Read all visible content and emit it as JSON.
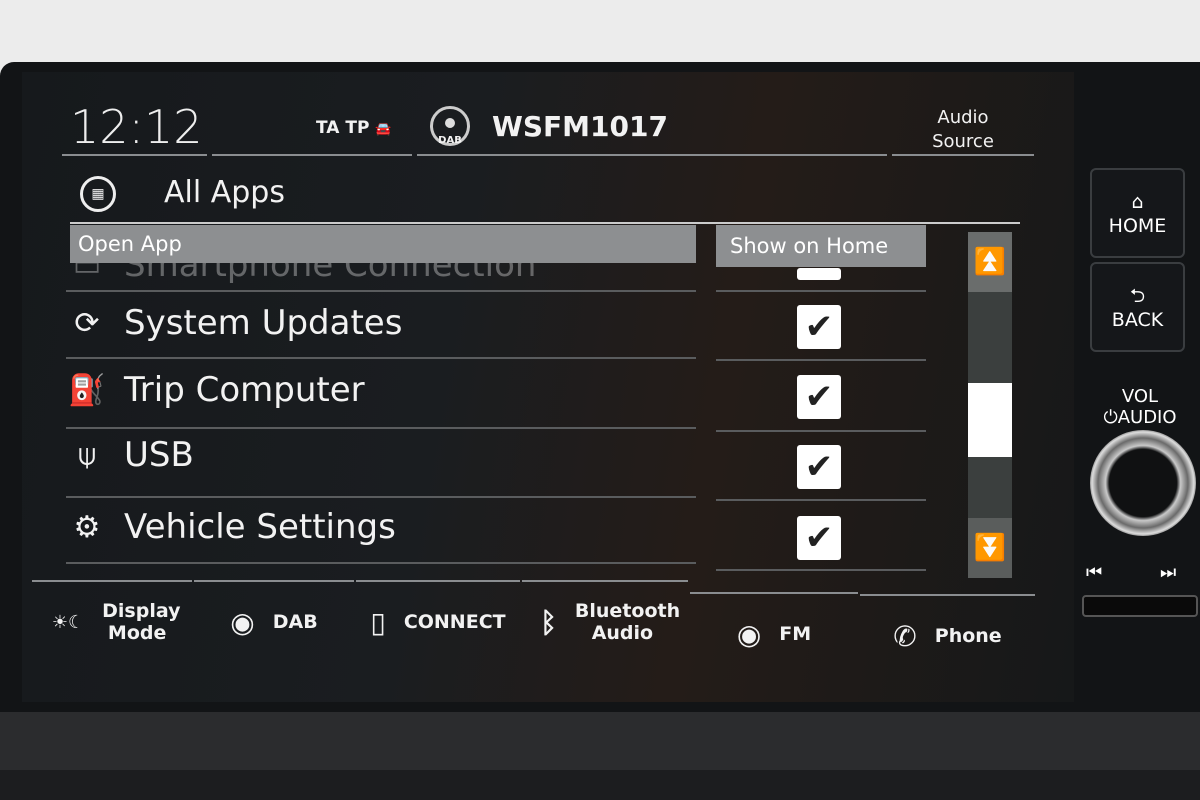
{
  "status": {
    "time": "12:12",
    "ta_tp": "TA TP",
    "traffic_icon": "traffic-signal-icon",
    "source_badge": "DAB",
    "station": "WSFM1017",
    "audio_source": "Audio Source"
  },
  "header": {
    "title": "All Apps",
    "icon": "grid-icon"
  },
  "columns": {
    "open_app": "Open App",
    "show_on_home": "Show on Home"
  },
  "apps": [
    {
      "label": "Smartphone Connection",
      "icon": "smartphone-icon",
      "checked": true
    },
    {
      "label": "System Updates",
      "icon": "refresh-icon",
      "checked": true
    },
    {
      "label": "Trip Computer",
      "icon": "fuel-pump-icon",
      "checked": true
    },
    {
      "label": "USB",
      "icon": "usb-icon",
      "checked": true
    },
    {
      "label": "Vehicle Settings",
      "icon": "car-gear-icon",
      "checked": true
    }
  ],
  "scroll": {
    "position_percent": 60
  },
  "bottom_bar": [
    {
      "label": "Display Mode",
      "icon": "sun-moon-icon"
    },
    {
      "label": "DAB",
      "icon": "broadcast-icon"
    },
    {
      "label": "CONNECT",
      "icon": "phone-device-icon"
    },
    {
      "label": "Bluetooth Audio",
      "icon": "bluetooth-icon"
    },
    {
      "label": "FM",
      "icon": "broadcast-icon"
    },
    {
      "label": "Phone",
      "icon": "phone-handset-icon"
    }
  ],
  "hardware": {
    "home": "HOME",
    "back": "BACK",
    "vol": "VOL",
    "audio": "AUDIO"
  }
}
